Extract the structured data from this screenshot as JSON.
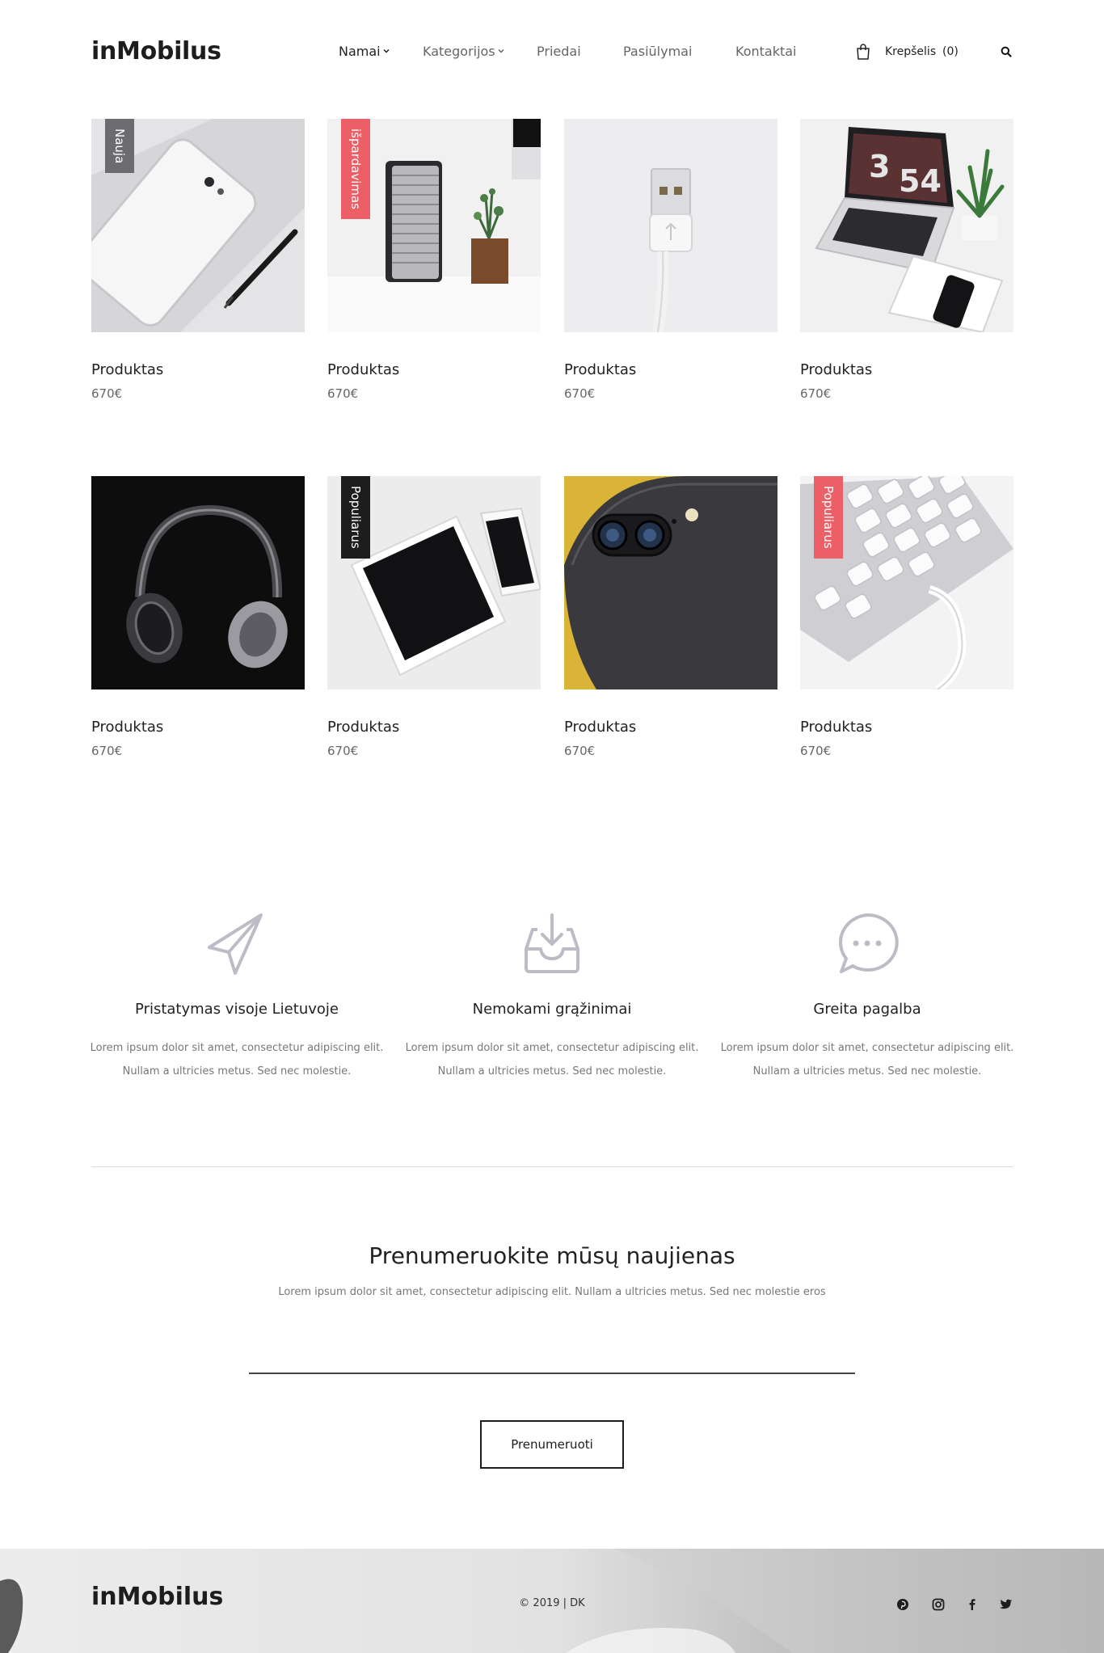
{
  "header": {
    "logo": "inMobilus",
    "nav": [
      {
        "label": "Namai",
        "dropdown": true,
        "active": true
      },
      {
        "label": "Kategorijos",
        "dropdown": true,
        "active": false
      },
      {
        "label": "Priedai",
        "dropdown": false,
        "active": false
      },
      {
        "label": "Pasiūlymai",
        "dropdown": false,
        "active": false
      },
      {
        "label": "Kontaktai",
        "dropdown": false,
        "active": false
      }
    ],
    "cart_label": "Krepšelis",
    "cart_count": "(0)",
    "search_icon": "search-icon"
  },
  "products": [
    {
      "name": "Produktas",
      "price": "670€",
      "badge": "Nauja",
      "badge_color": "#6b6b70",
      "image": "white-iphone-with-pen"
    },
    {
      "name": "Produktas",
      "price": "670€",
      "badge": "išpardavimas",
      "badge_color": "#ec5f66",
      "image": "speaker-and-plant"
    },
    {
      "name": "Produktas",
      "price": "670€",
      "badge": "",
      "badge_color": "",
      "image": "usb-cable"
    },
    {
      "name": "Produktas",
      "price": "670€",
      "badge": "",
      "badge_color": "",
      "image": "laptop-plant-phone"
    },
    {
      "name": "Produktas",
      "price": "670€",
      "badge": "",
      "badge_color": "",
      "image": "headphones"
    },
    {
      "name": "Produktas",
      "price": "670€",
      "badge": "Populiarus",
      "badge_color": "#1d1d1d",
      "image": "tablet-and-phone"
    },
    {
      "name": "Produktas",
      "price": "670€",
      "badge": "",
      "badge_color": "",
      "image": "black-iphone-camera"
    },
    {
      "name": "Produktas",
      "price": "670€",
      "badge": "Populiarus",
      "badge_color": "#ec5f66",
      "image": "keyboard-cable"
    }
  ],
  "features": [
    {
      "icon": "paper-plane-icon",
      "title": "Pristatymas visoje Lietuvoje",
      "text": "Lorem ipsum dolor sit amet, consectetur adipiscing elit. Nullam a ultricies metus. Sed nec molestie."
    },
    {
      "icon": "inbox-download-icon",
      "title": "Nemokami grąžinimai",
      "text": "Lorem ipsum dolor sit amet, consectetur adipiscing elit. Nullam a ultricies metus. Sed nec molestie."
    },
    {
      "icon": "chat-bubble-icon",
      "title": "Greita pagalba",
      "text": "Lorem ipsum dolor sit amet, consectetur adipiscing elit. Nullam a ultricies metus. Sed nec molestie."
    }
  ],
  "newsletter": {
    "title": "Prenumeruokite mūsų naujienas",
    "text": "Lorem ipsum dolor sit amet, consectetur adipiscing elit. Nullam a ultricies metus. Sed nec molestie eros",
    "input_value": "",
    "button_label": "Prenumeruoti"
  },
  "footer": {
    "logo": "inMobilus",
    "copyright": "© 2019 | DK",
    "social": [
      "pinterest-icon",
      "instagram-icon",
      "facebook-icon",
      "twitter-icon"
    ]
  },
  "colors": {
    "accent_red": "#ec5f66",
    "badge_gray": "#6b6b70",
    "text_dark": "#1d1d1d",
    "text_muted": "#777777",
    "icon_stroke": "#bdbcc6"
  }
}
